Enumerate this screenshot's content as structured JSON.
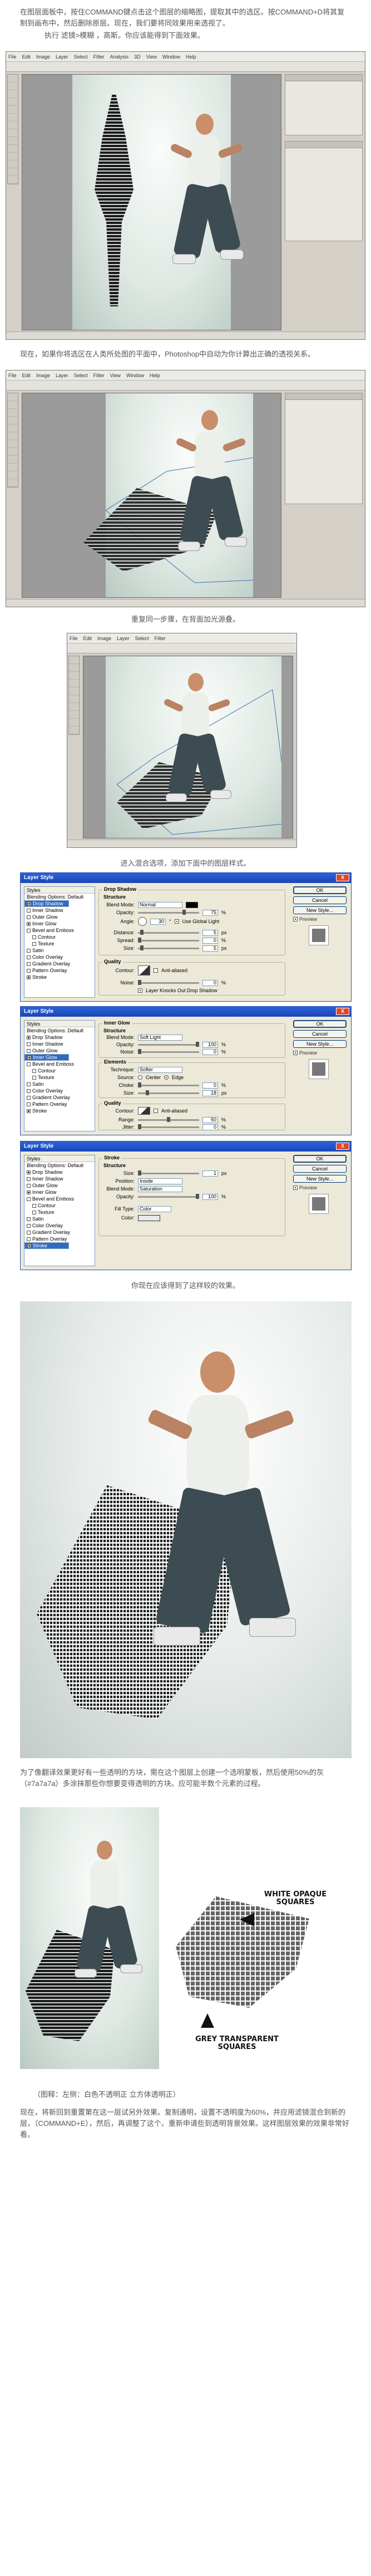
{
  "paragraphs": {
    "p1": "在图层面板中，按住COMMAND键点击这个图层的缩略图，提取其中的选区。按COMMAND+D将其复制到画布中，然后删除原层。现在，我们要将同效果用来透视了。",
    "p2": "执行 滤镜>模糊 ，高斯。你应该能得到下面效果。",
    "p3": "现在，如果你将选区在人类所处图的平面中，Photoshop中自动为你计算出正确的透视关系。",
    "p4": "重复同一步骤，在背面加光源叠。",
    "p5": "进入混合选项，添加下面中的图层样式。",
    "p6": "你现在应该得到了这样较的效果。",
    "p7": "为了像翻译效果更好有一些透明的方块，需在这个图层上创建一个选明蒙板，然后使用50%的灰（#7a7a7a）多涂抹那些你想要变得透明的方块。应可能半数个元素的过程。",
    "p8": "（图释：左侧：白色不透明正 立方体透明正）",
    "p9": "现在，将新回到重置第在这一层试另外效果。复制通明，设置不透明度为60%，并应用滤镜混合到新的层，（COMMAND+E），然后，再调整了这个。重新申请些到透明背景效果。这样图层效果的效果非常好看。"
  },
  "photoshop": {
    "menu_items": [
      "File",
      "Edit",
      "Image",
      "Layer",
      "Select",
      "Filter",
      "Analysis",
      "3D",
      "View",
      "Window",
      "Help"
    ]
  },
  "dialogs": [
    {
      "title": "Layer Style",
      "close": "X",
      "styles_header": "Styles",
      "blend_default": "Blending Options: Default",
      "items": [
        {
          "label": "Drop Shadow",
          "checked": true,
          "selected": true
        },
        {
          "label": "Inner Shadow",
          "checked": false
        },
        {
          "label": "Outer Glow",
          "checked": false
        },
        {
          "label": "Inner Glow",
          "checked": true
        },
        {
          "label": "Bevel and Emboss",
          "checked": false
        },
        {
          "label": "Contour",
          "checked": false,
          "indent": true
        },
        {
          "label": "Texture",
          "checked": false,
          "indent": true
        },
        {
          "label": "Satin",
          "checked": false
        },
        {
          "label": "Color Overlay",
          "checked": false
        },
        {
          "label": "Gradient Overlay",
          "checked": false
        },
        {
          "label": "Pattern Overlay",
          "checked": false
        },
        {
          "label": "Stroke",
          "checked": true
        }
      ],
      "section": "Drop Shadow",
      "sub": "Structure",
      "blend_mode_label": "Blend Mode:",
      "blend_mode": "Normal",
      "opacity_label": "Opacity:",
      "opacity": "75",
      "angle_label": "Angle:",
      "angle": "30",
      "global_light": "Use Global Light",
      "distance_label": "Distance:",
      "distance": "5",
      "spread_label": "Spread:",
      "spread": "0",
      "size_label": "Size:",
      "size": "5",
      "quality": "Quality",
      "contour_label": "Contour:",
      "anti_aliased": "Anti-aliased",
      "noise_label": "Noise:",
      "noise": "0",
      "knockout": "Layer Knocks Out Drop Shadow",
      "buttons": {
        "ok": "OK",
        "cancel": "Cancel",
        "new_style": "New Style...",
        "preview": "Preview"
      }
    },
    {
      "title": "Layer Style",
      "close": "X",
      "styles_header": "Styles",
      "blend_default": "Blending Options: Default",
      "items": [
        {
          "label": "Drop Shadow",
          "checked": true
        },
        {
          "label": "Inner Shadow",
          "checked": false
        },
        {
          "label": "Outer Glow",
          "checked": false
        },
        {
          "label": "Inner Glow",
          "checked": true,
          "selected": true
        },
        {
          "label": "Bevel and Emboss",
          "checked": false
        },
        {
          "label": "Contour",
          "checked": false,
          "indent": true
        },
        {
          "label": "Texture",
          "checked": false,
          "indent": true
        },
        {
          "label": "Satin",
          "checked": false
        },
        {
          "label": "Color Overlay",
          "checked": false
        },
        {
          "label": "Gradient Overlay",
          "checked": false
        },
        {
          "label": "Pattern Overlay",
          "checked": false
        },
        {
          "label": "Stroke",
          "checked": true
        }
      ],
      "section": "Inner Glow",
      "sub": "Structure",
      "blend_mode_label": "Blend Mode:",
      "blend_mode": "Soft Light",
      "opacity_label": "Opacity:",
      "opacity": "100",
      "noise_label": "Noise:",
      "noise": "0",
      "elements": "Elements",
      "technique_label": "Technique:",
      "technique": "Softer",
      "source_label": "Source:",
      "center": "Center",
      "edge": "Edge",
      "choke_label": "Choke:",
      "choke": "0",
      "size_label": "Size:",
      "size": "18",
      "quality": "Quality",
      "contour_label": "Contour:",
      "anti_aliased": "Anti-aliased",
      "range_label": "Range:",
      "range": "50",
      "jitter_label": "Jitter:",
      "jitter": "0",
      "buttons": {
        "ok": "OK",
        "cancel": "Cancel",
        "new_style": "New Style...",
        "preview": "Preview"
      }
    },
    {
      "title": "Layer Style",
      "close": "X",
      "styles_header": "Styles",
      "blend_default": "Blending Options: Default",
      "items": [
        {
          "label": "Drop Shadow",
          "checked": true
        },
        {
          "label": "Inner Shadow",
          "checked": false
        },
        {
          "label": "Outer Glow",
          "checked": false
        },
        {
          "label": "Inner Glow",
          "checked": true
        },
        {
          "label": "Bevel and Emboss",
          "checked": false
        },
        {
          "label": "Contour",
          "checked": false,
          "indent": true
        },
        {
          "label": "Texture",
          "checked": false,
          "indent": true
        },
        {
          "label": "Satin",
          "checked": false
        },
        {
          "label": "Color Overlay",
          "checked": false
        },
        {
          "label": "Gradient Overlay",
          "checked": false
        },
        {
          "label": "Pattern Overlay",
          "checked": false
        },
        {
          "label": "Stroke",
          "checked": true,
          "selected": true
        }
      ],
      "section": "Stroke",
      "sub": "Structure",
      "size_label": "Size:",
      "size": "1",
      "size_unit": "px",
      "position_label": "Position:",
      "position": "Inside",
      "blend_mode_label": "Blend Mode:",
      "blend_mode": "Saturation",
      "opacity_label": "Opacity:",
      "opacity": "100",
      "fill_type_label": "Fill Type:",
      "fill_type": "Color",
      "color_label": "Color:",
      "buttons": {
        "ok": "OK",
        "cancel": "Cancel",
        "new_style": "New Style...",
        "preview": "Preview"
      }
    }
  ],
  "annotations": {
    "white": "WHITE OPAQUE\nSQUARES",
    "grey": "GREY TRANSPARENT\nSQUARES"
  },
  "colors": {
    "canvas_bg": "#dfe8e3",
    "dialog_title": "#1846b8",
    "dialog_bg": "#ece9d8",
    "swatch_shadow": "#000000",
    "swatch_stroke": "#e8e8e8"
  }
}
